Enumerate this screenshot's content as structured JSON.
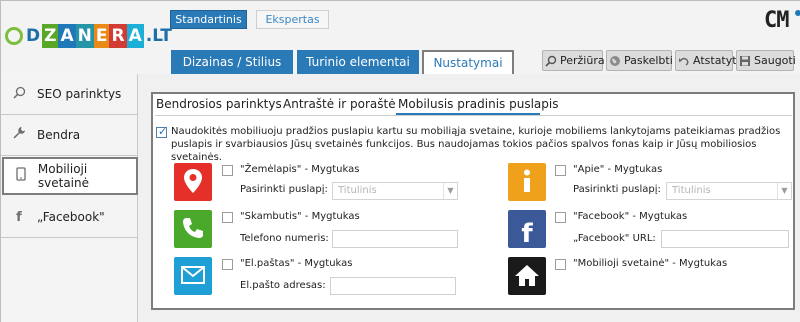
{
  "header": {
    "logo": {
      "letters": [
        "D",
        "Z",
        "A",
        "N",
        "E",
        "R",
        "A",
        ".LT"
      ]
    },
    "modes": {
      "standard": "Standartinis",
      "expert": "Ekspertas"
    },
    "cms_mark": "CM"
  },
  "tabs": {
    "design": "Dizainas / Stilius",
    "content": "Turinio elementai",
    "settings": "Nustatymai"
  },
  "toolbar": {
    "preview": "Peržiūra",
    "publish": "Paskelbti",
    "restore": "Atstatyti",
    "save": "Saugoti"
  },
  "sidebar": {
    "items": [
      {
        "label": "SEO parinktys",
        "icon": "search-icon"
      },
      {
        "label": "Bendra",
        "icon": "wrench-icon"
      },
      {
        "label": "Mobilioji svetainė",
        "icon": "mobile-icon"
      },
      {
        "label": "„Facebook\"",
        "icon": "facebook-icon"
      }
    ]
  },
  "subtabs": {
    "general": "Bendrosios parinktys",
    "header_footer": "Antraštė ir poraštė",
    "mobile_home": "Mobilusis pradinis puslapis"
  },
  "mobile": {
    "enabled": true,
    "description": "Naudokitės mobiliuoju pradžios puslapiu kartu su mobiliąja svetaine, kurioje mobiliems lankytojams pateikiamas pradžios puslapis ir svarbiausios Jūsų svetainės funkcijos. Bus naudojamas tokios pačios spalvos fonas kaip ir Jūsų mobiliosios svetainės.",
    "map": {
      "title": "\"Žemėlapis\" - Mygtukas",
      "label": "Pasirinkti puslapį:",
      "select_value": "Titulinis",
      "color": "#e5302a"
    },
    "about": {
      "title": "\"Apie\" - Mygtukas",
      "label": "Pasirinkti puslapį:",
      "select_value": "Titulinis",
      "color": "#f0a11b"
    },
    "call": {
      "title": "\"Skambutis\" - Mygtukas",
      "label": "Telefono numeris:",
      "color": "#4aa82b"
    },
    "facebook": {
      "title": "\"Facebook\" - Mygtukas",
      "label": "„Facebook\" URL:",
      "color": "#3b5998"
    },
    "email": {
      "title": "\"El.paštas\" - Mygtukas",
      "label": "El.pašto adresas:",
      "color": "#1ea0d6"
    },
    "mobilesite": {
      "title": "\"Mobilioji svetainė\" - Mygtukas",
      "color": "#1a1a1a"
    }
  }
}
